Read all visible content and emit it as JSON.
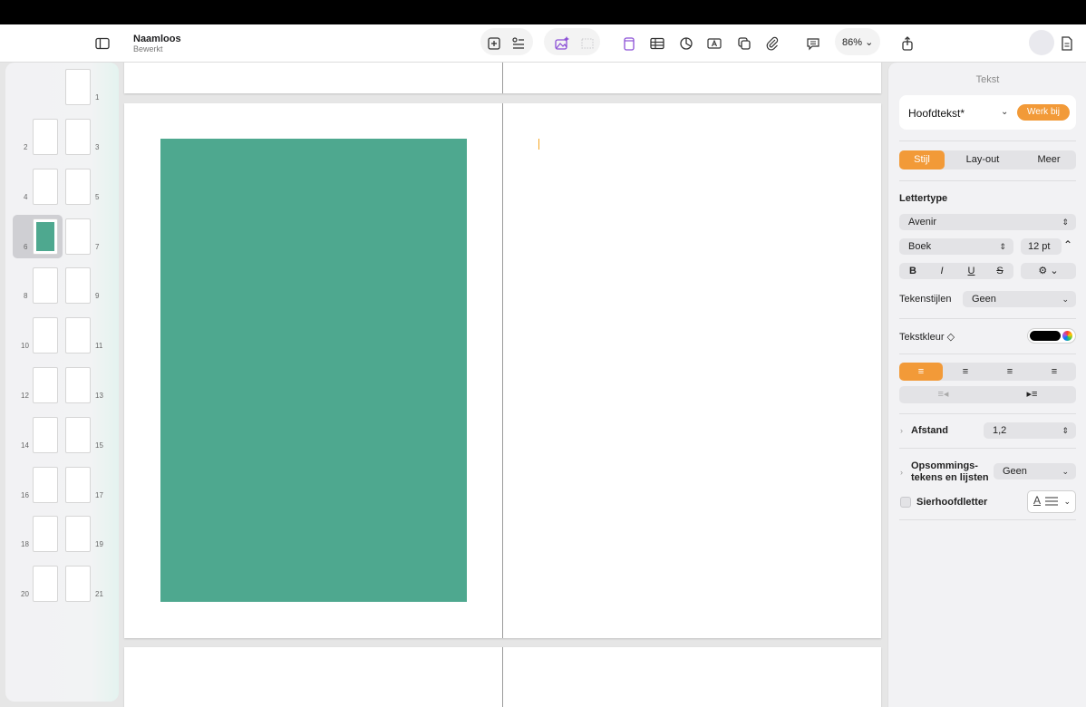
{
  "document": {
    "title": "Naamloos",
    "subtitle": "Bewerkt"
  },
  "toolbar": {
    "zoom": "86%",
    "icons": [
      "sidebar-toggle-icon",
      "add-page-icon",
      "list-icon",
      "image-playground-icon",
      "media-placeholder-icon",
      "text-box-icon",
      "table-icon",
      "chart-icon",
      "text-icon",
      "shape-icon",
      "attachment-icon",
      "comment-icon",
      "share-icon",
      "format-brush-icon",
      "document-icon"
    ]
  },
  "sidebar": {
    "pages": [
      "1",
      "2",
      "3",
      "4",
      "5",
      "6",
      "7",
      "8",
      "9",
      "10",
      "11",
      "12",
      "13",
      "14",
      "15",
      "16",
      "17",
      "18",
      "19",
      "20",
      "21"
    ],
    "selected_page": "6"
  },
  "inspector": {
    "title": "Tekst",
    "paragraph_style": "Hoofdtekst*",
    "update_button": "Werk bij",
    "tabs": [
      "Stijl",
      "Lay-out",
      "Meer"
    ],
    "active_tab": "Stijl",
    "font_heading": "Lettertype",
    "font_family": "Avenir",
    "font_weight": "Boek",
    "font_size": "12 pt",
    "format_buttons": [
      "B",
      "I",
      "U",
      "S"
    ],
    "char_styles_label": "Tekenstijlen",
    "char_styles_value": "Geen",
    "text_color_label": "Tekstkleur ◇",
    "text_color": "#000000",
    "alignment": [
      "left",
      "center",
      "right",
      "justify"
    ],
    "active_alignment": "left",
    "spacing_label": "Afstand",
    "spacing_value": "1,2",
    "bullets_label_1": "Opsommings-",
    "bullets_label_2": "tekens en lijsten",
    "bullets_value": "Geen",
    "dropcap_label": "Sierhoofdletter",
    "dropcap_letter": "A"
  },
  "colors": {
    "accent": "#f29a38",
    "shape_fill": "#4ea88f"
  }
}
